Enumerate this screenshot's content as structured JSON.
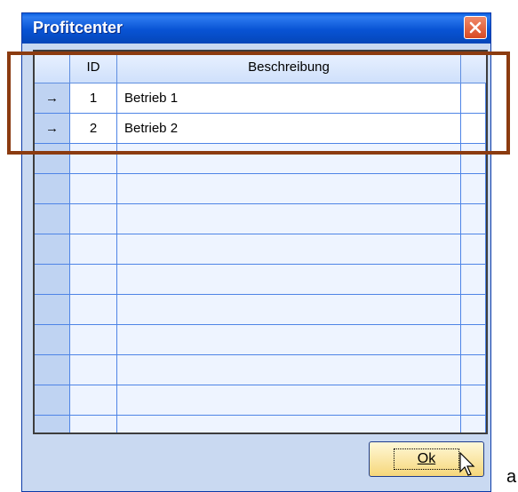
{
  "window": {
    "title": "Profitcenter",
    "close_icon": "close-icon",
    "accent": "#0853d4",
    "close_color": "#d94a22"
  },
  "grid": {
    "columns": [
      "",
      "ID",
      "Beschreibung",
      ""
    ],
    "rows": [
      {
        "indicator": "→",
        "id": "1",
        "description": "Betrieb 1"
      },
      {
        "indicator": "→",
        "id": "2",
        "description": "Betrieb 2"
      }
    ]
  },
  "ok_button": {
    "label": "Ok"
  },
  "annotation": {
    "highlight_color": "#8b3b10",
    "trailing_text": "a"
  }
}
